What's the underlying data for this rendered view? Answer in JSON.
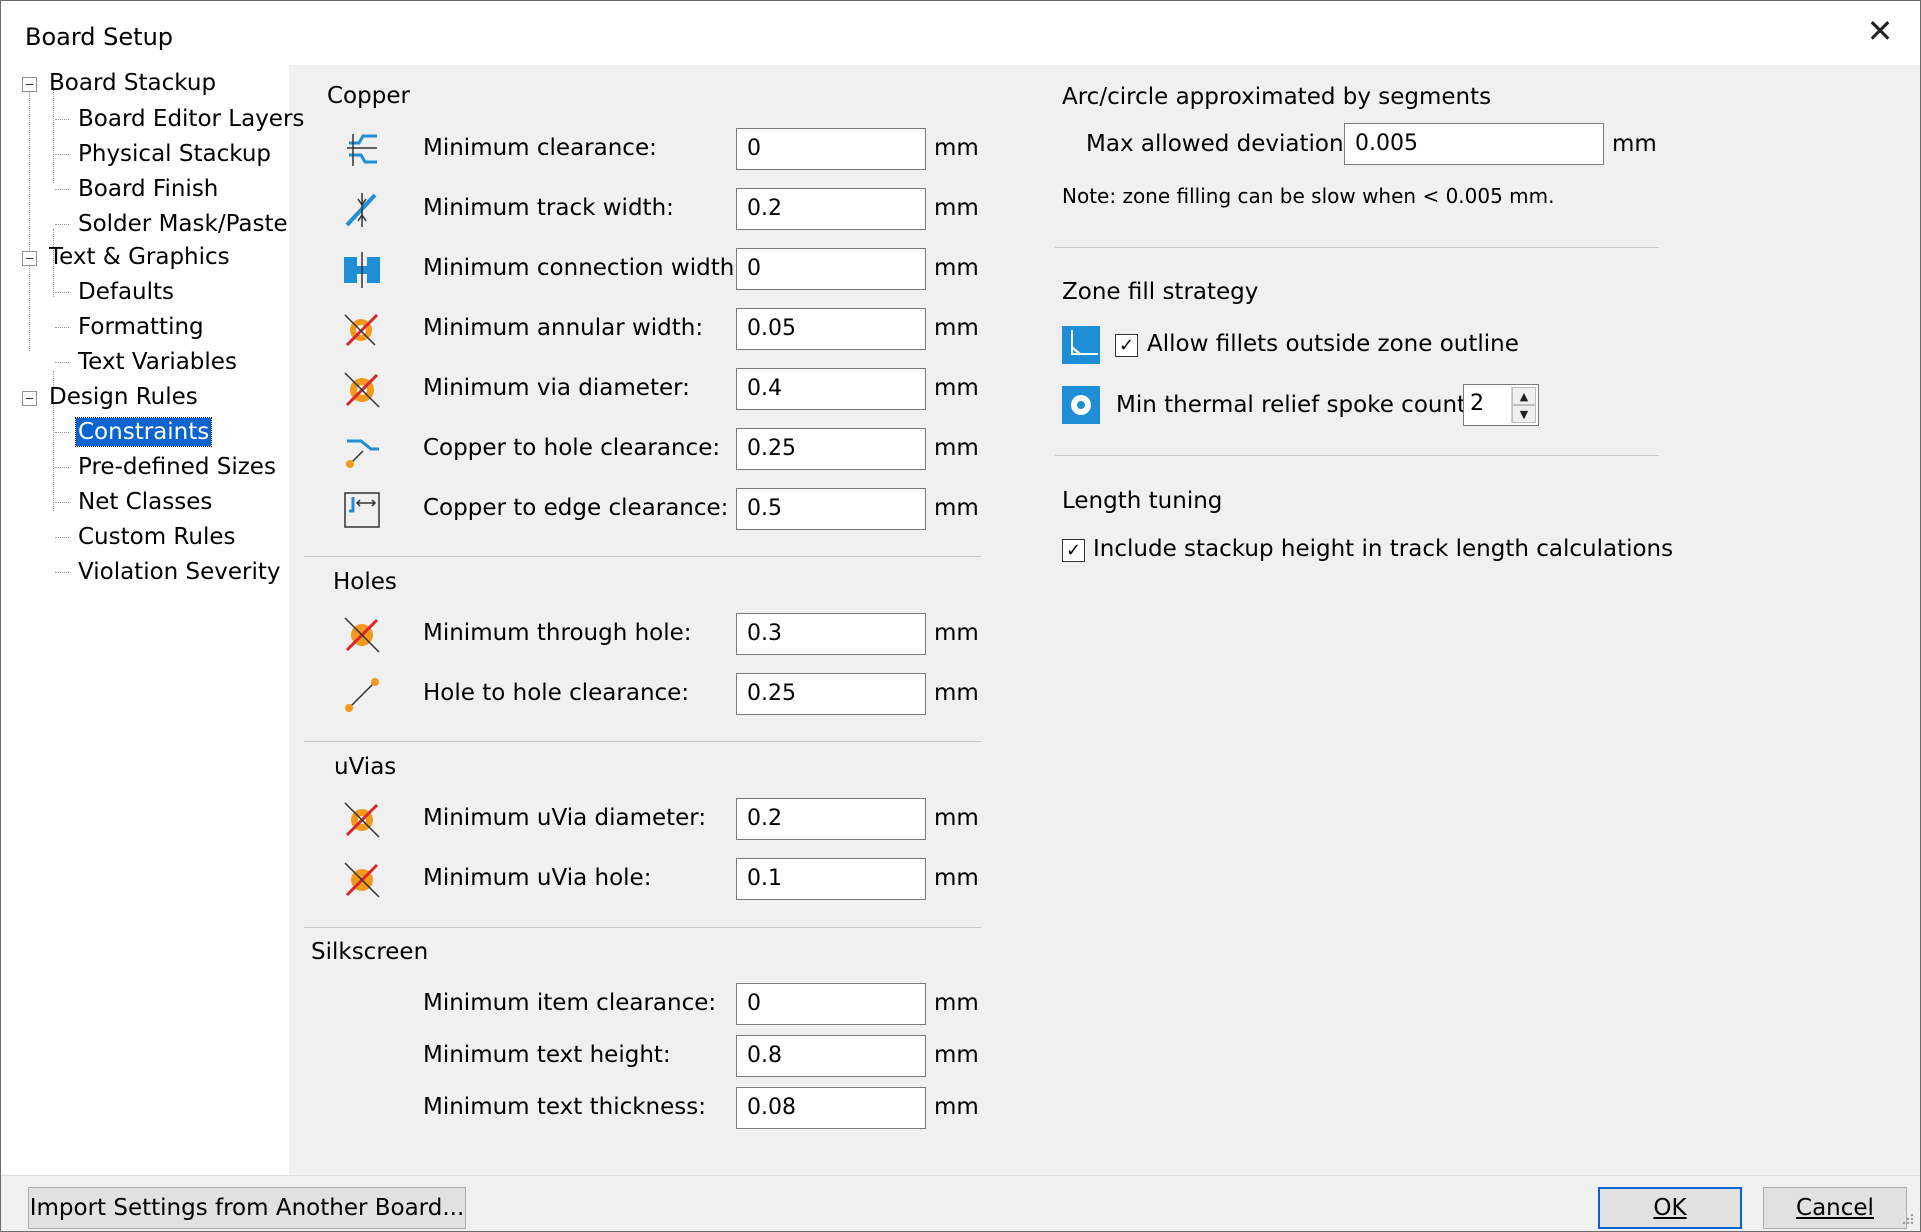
{
  "window": {
    "title": "Board Setup",
    "close_label": "✕"
  },
  "tree": {
    "groups": [
      {
        "label": "Board Stackup",
        "items": [
          "Board Editor Layers",
          "Physical Stackup",
          "Board Finish",
          "Solder Mask/Paste"
        ]
      },
      {
        "label": "Text & Graphics",
        "items": [
          "Defaults",
          "Formatting",
          "Text Variables"
        ]
      },
      {
        "label": "Design Rules",
        "items": [
          "Constraints",
          "Pre-defined Sizes",
          "Net Classes",
          "Custom Rules",
          "Violation Severity"
        ]
      }
    ],
    "selected": "Constraints"
  },
  "copper": {
    "title": "Copper",
    "rows": [
      {
        "label": "Minimum clearance:",
        "value": "0",
        "unit": "mm",
        "icon": "clearance-icon"
      },
      {
        "label": "Minimum track width:",
        "value": "0.2",
        "unit": "mm",
        "icon": "track-width-icon"
      },
      {
        "label": "Minimum connection width:",
        "value": "0",
        "unit": "mm",
        "icon": "connection-width-icon"
      },
      {
        "label": "Minimum annular width:",
        "value": "0.05",
        "unit": "mm",
        "icon": "annular-width-icon"
      },
      {
        "label": "Minimum via diameter:",
        "value": "0.4",
        "unit": "mm",
        "icon": "via-diameter-icon"
      },
      {
        "label": "Copper to hole clearance:",
        "value": "0.25",
        "unit": "mm",
        "icon": "hole-clearance-icon"
      },
      {
        "label": "Copper to edge clearance:",
        "value": "0.5",
        "unit": "mm",
        "icon": "edge-clearance-icon"
      }
    ]
  },
  "holes": {
    "title": "Holes",
    "rows": [
      {
        "label": "Minimum through hole:",
        "value": "0.3",
        "unit": "mm",
        "icon": "through-hole-icon"
      },
      {
        "label": "Hole to hole clearance:",
        "value": "0.25",
        "unit": "mm",
        "icon": "hole-to-hole-icon"
      }
    ]
  },
  "uvias": {
    "title": "uVias",
    "rows": [
      {
        "label": "Minimum uVia diameter:",
        "value": "0.2",
        "unit": "mm",
        "icon": "uvia-diameter-icon"
      },
      {
        "label": "Minimum uVia hole:",
        "value": "0.1",
        "unit": "mm",
        "icon": "uvia-hole-icon"
      }
    ]
  },
  "silkscreen": {
    "title": "Silkscreen",
    "rows": [
      {
        "label": "Minimum item clearance:",
        "value": "0",
        "unit": "mm"
      },
      {
        "label": "Minimum text height:",
        "value": "0.8",
        "unit": "mm"
      },
      {
        "label": "Minimum text thickness:",
        "value": "0.08",
        "unit": "mm"
      }
    ]
  },
  "arc": {
    "title": "Arc/circle approximated by segments",
    "label": "Max allowed deviation:",
    "value": "0.005",
    "unit": "mm",
    "note": "Note: zone filling can be slow when < 0.005 mm."
  },
  "zone": {
    "title": "Zone fill strategy",
    "fillets_label": "Allow fillets outside zone outline",
    "fillets_checked": true,
    "spoke_label": "Min thermal relief spoke count:",
    "spoke_value": "2"
  },
  "length": {
    "title": "Length tuning",
    "stackup_label": "Include stackup height in track length calculations",
    "stackup_checked": true
  },
  "buttons": {
    "import": "Import Settings from Another Board...",
    "ok": "OK",
    "cancel": "Cancel"
  },
  "colors": {
    "accent": "#0a64cf",
    "icon_blue": "#1e8fd6",
    "icon_orange": "#f39a1e",
    "icon_red": "#d9262c"
  }
}
